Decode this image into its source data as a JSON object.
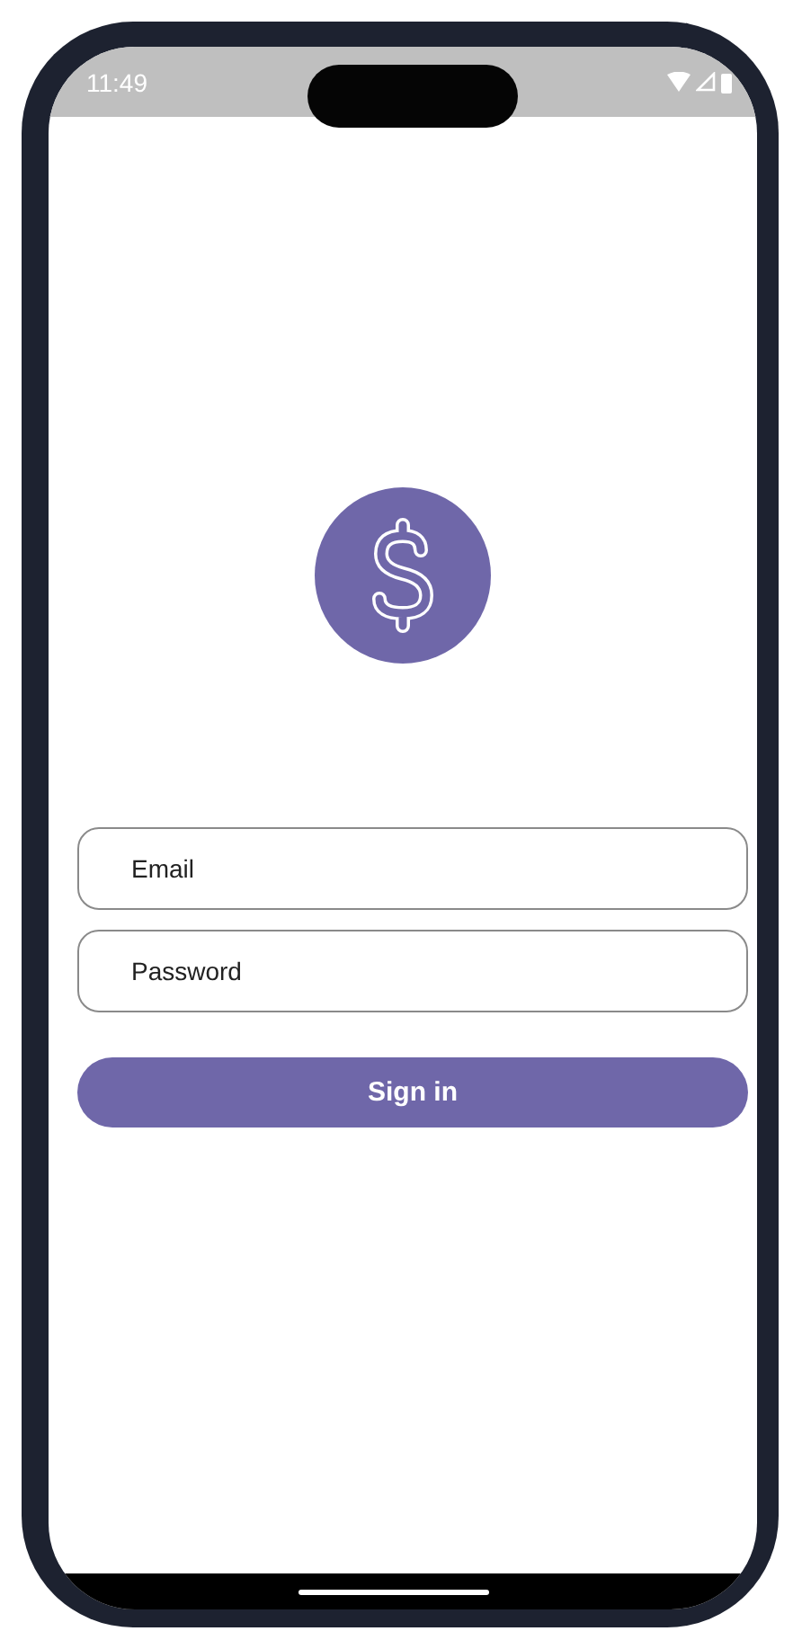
{
  "status_bar": {
    "time": "11:49"
  },
  "form": {
    "email": {
      "placeholder": "Email"
    },
    "password": {
      "placeholder": "Password"
    }
  },
  "buttons": [
    {
      "label": "Sign in"
    }
  ]
}
